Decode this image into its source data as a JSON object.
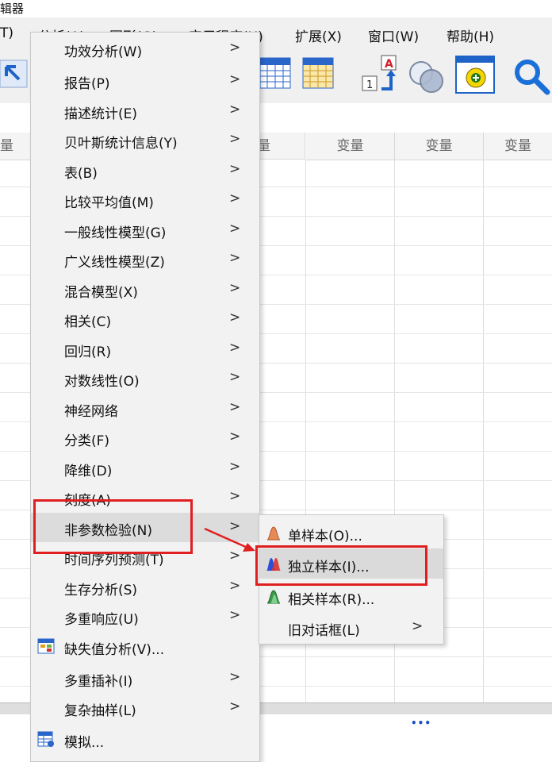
{
  "window_title_fragment": "辑器",
  "menubar": {
    "items": [
      "T)",
      "分析(A)",
      "图形(G)",
      "实用程序(U)",
      "扩展(X)",
      "窗口(W)",
      "帮助(H)"
    ]
  },
  "grid": {
    "column_header_label": "变量",
    "column_headers": [
      "量",
      "量",
      "变量",
      "变量",
      "变量"
    ]
  },
  "analyze_menu": {
    "items": [
      {
        "label": "功效分析(W)",
        "submenu": true
      },
      {
        "label": "报告(P)",
        "submenu": true
      },
      {
        "label": "描述统计(E)",
        "submenu": true
      },
      {
        "label": "贝叶斯统计信息(Y)",
        "submenu": true
      },
      {
        "label": "表(B)",
        "submenu": true
      },
      {
        "label": "比较平均值(M)",
        "submenu": true
      },
      {
        "label": "一般线性模型(G)",
        "submenu": true
      },
      {
        "label": "广义线性模型(Z)",
        "submenu": true
      },
      {
        "label": "混合模型(X)",
        "submenu": true
      },
      {
        "label": "相关(C)",
        "submenu": true
      },
      {
        "label": "回归(R)",
        "submenu": true
      },
      {
        "label": "对数线性(O)",
        "submenu": true
      },
      {
        "label": "神经网络",
        "submenu": true
      },
      {
        "label": "分类(F)",
        "submenu": true
      },
      {
        "label": "降维(D)",
        "submenu": true
      },
      {
        "label": "刻度(A)",
        "submenu": true
      },
      {
        "label": "非参数检验(N)",
        "submenu": true,
        "highlighted": true
      },
      {
        "label": "时间序列预测(T)",
        "submenu": true
      },
      {
        "label": "生存分析(S)",
        "submenu": true
      },
      {
        "label": "多重响应(U)",
        "submenu": true
      },
      {
        "label": "缺失值分析(V)...",
        "submenu": false,
        "icon": "missing-value-icon"
      },
      {
        "label": "多重插补(I)",
        "submenu": true
      },
      {
        "label": "复杂抽样(L)",
        "submenu": true
      },
      {
        "label": "模拟...",
        "submenu": false,
        "icon": "simulation-icon"
      }
    ]
  },
  "nonparametric_submenu": {
    "items": [
      {
        "label": "单样本(O)...",
        "icon": "one-sample-icon"
      },
      {
        "label": "独立样本(I)...",
        "icon": "independent-samples-icon",
        "highlighted": true
      },
      {
        "label": "相关样本(R)...",
        "icon": "related-samples-icon"
      },
      {
        "label": "旧对话框(L)",
        "submenu": true
      }
    ]
  },
  "colors": {
    "highlight_box": "#e02020",
    "menu_bg": "#f2f2f2"
  },
  "glyphs": {
    "submenu_arrow": ">",
    "ellipsis_dots": "•••"
  }
}
